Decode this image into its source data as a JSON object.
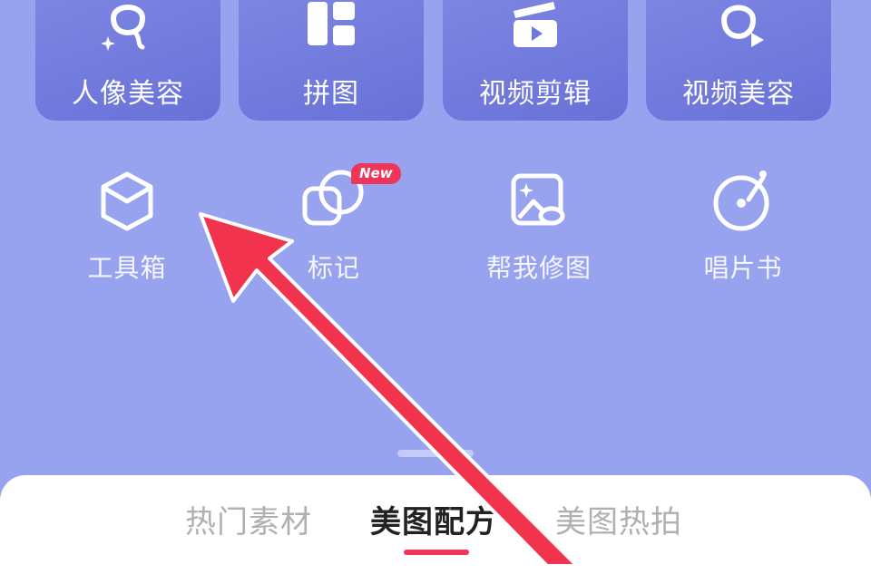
{
  "top_tiles": [
    {
      "label": "人像美容",
      "icon": "portrait-icon"
    },
    {
      "label": "拼图",
      "icon": "collage-icon"
    },
    {
      "label": "视频剪辑",
      "icon": "video-clapper-icon"
    },
    {
      "label": "视频美容",
      "icon": "video-beauty-icon"
    }
  ],
  "tools": [
    {
      "label": "工具箱",
      "icon": "cube-icon"
    },
    {
      "label": "标记",
      "icon": "overlap-squares-icon",
      "badge": "New"
    },
    {
      "label": "帮我修图",
      "icon": "photo-edit-icon"
    },
    {
      "label": "唱片书",
      "icon": "record-player-icon"
    }
  ],
  "tabs": [
    {
      "label": "热门素材",
      "active": false
    },
    {
      "label": "美图配方",
      "active": true
    },
    {
      "label": "美图热拍",
      "active": false
    }
  ],
  "colors": {
    "background": "#97a3ee",
    "tile": "#6f78dc",
    "accent": "#f0355a",
    "annotation_arrow": "#f2334d"
  }
}
